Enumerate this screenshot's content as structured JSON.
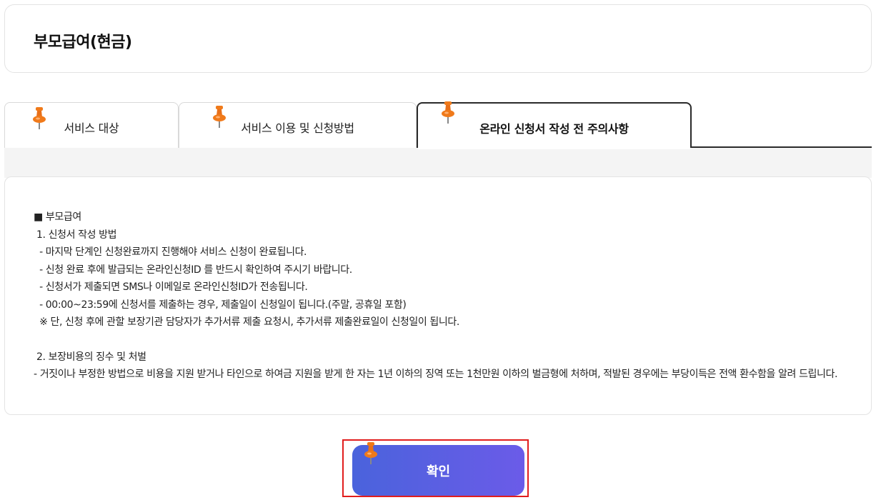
{
  "page": {
    "title": "부모급여(현금)"
  },
  "tabs": [
    {
      "label": "서비스 대상",
      "active": false
    },
    {
      "label": "서비스 이용 및 신청방법",
      "active": false
    },
    {
      "label": "온라인 신청서 작성 전 주의사항",
      "active": true
    }
  ],
  "notice": {
    "heading": "■ 부모급여",
    "section1": {
      "title": " 1. 신청서 작성 방법",
      "items": [
        "  - 마지막 단계인 신청완료까지 진행해야 서비스 신청이 완료됩니다.",
        "  - 신청 완료 후에 발급되는 온라인신청ID 를 반드시 확인하여 주시기 바랍니다.",
        "  - 신청서가 제출되면 SMS나 이메일로 온라인신청ID가 전송됩니다.",
        "  - 00:00~23:59에 신청서를 제출하는 경우, 제출일이 신청일이 됩니다.(주말, 공휴일 포함)",
        "  ※ 단, 신청 후에 관할 보장기관 담당자가 추가서류 제출 요청시, 추가서류 제출완료일이 신청일이 됩니다."
      ]
    },
    "section2": {
      "title": " 2. 보장비용의 징수 및 처벌",
      "body": "    - 거짓이나 부정한 방법으로 비용을 지원 받거나 타인으로 하여금 지원을 받게 한 자는 1년 이하의 징역 또는 1천만원 이하의 벌금형에 처하며, 적발된 경우에는 부당이득은 전액 환수함을 알려 드립니다."
    }
  },
  "confirm_button": {
    "label": "확인"
  },
  "colors": {
    "accent_start": "#4a63dc",
    "accent_end": "#6b5be8",
    "pin": "#f07a1a",
    "highlight": "#e11d1d"
  },
  "icons": [
    "pushpin-icon"
  ]
}
